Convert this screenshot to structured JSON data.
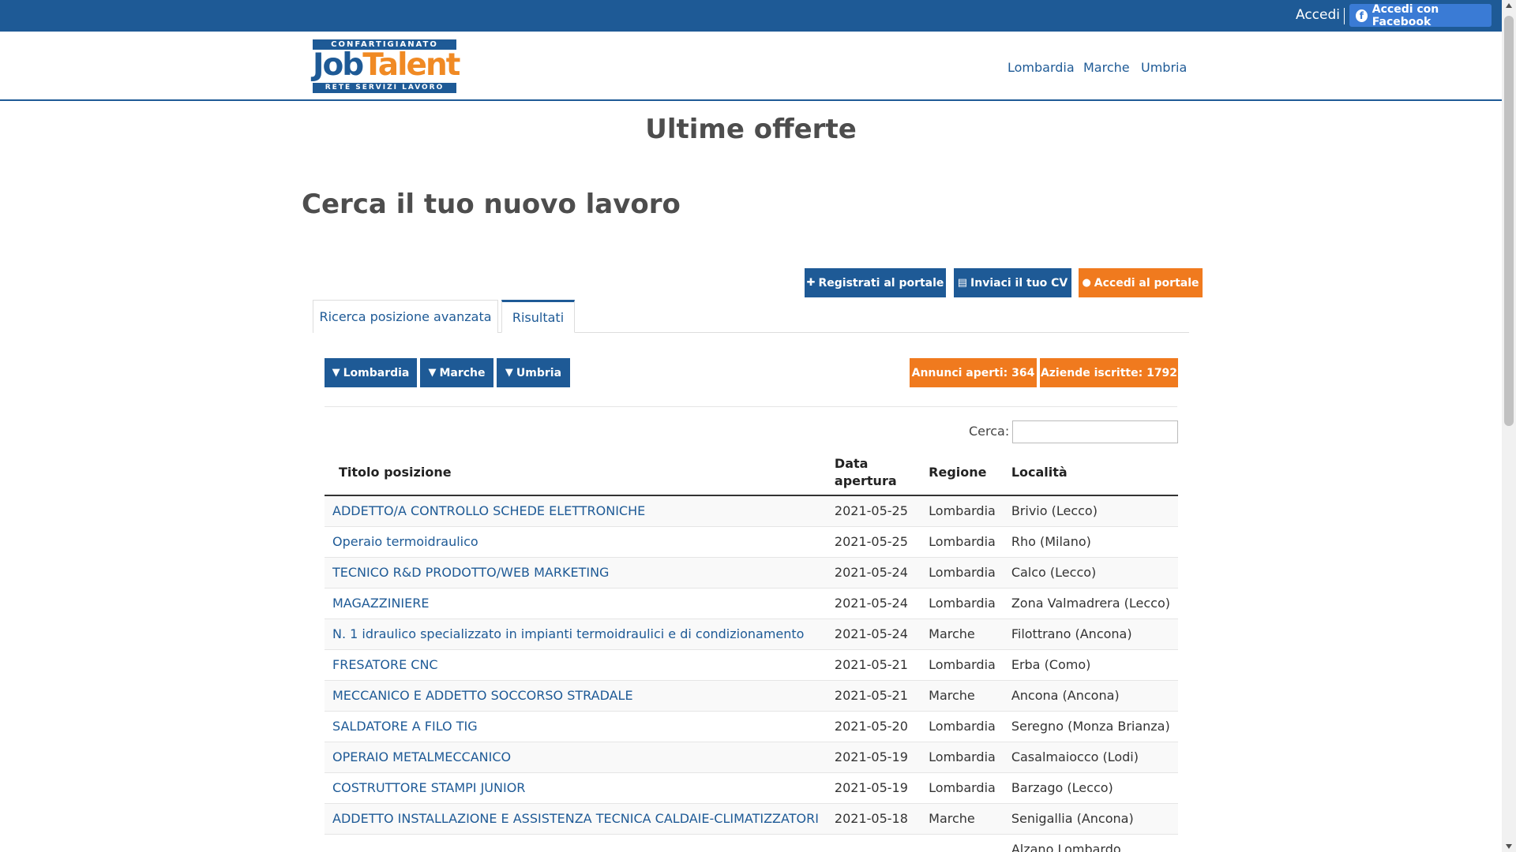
{
  "topbar": {
    "login_label": "Accedi",
    "facebook_label": "Accedi con Facebook"
  },
  "logo": {
    "top_text": "CONFARTIGIANATO",
    "brand_job": "Job",
    "brand_talent": "Talent",
    "bottom_text": "RETE SERVIZI LAVORO"
  },
  "nav": {
    "items": [
      "Lombardia",
      "Marche",
      "Umbria"
    ]
  },
  "main_title": "Ultime offerte",
  "sub_title": "Cerca il tuo nuovo lavoro",
  "actions": {
    "register": "Registrati al portale",
    "send_cv": "Inviaci il tuo CV",
    "login_portal": "Accedi al portale"
  },
  "tabs": {
    "advanced": "Ricerca posizione avanzata",
    "results": "Risultati"
  },
  "filters": [
    "Lombardia",
    "Marche",
    "Umbria"
  ],
  "stats": {
    "open_ads": "Annunci aperti: 364",
    "companies": "Aziende iscritte: 1792"
  },
  "search": {
    "label": "Cerca:"
  },
  "table": {
    "headers": {
      "title": "Titolo posizione",
      "date_line1": "Data",
      "date_line2": "apertura",
      "region": "Regione",
      "location": "Località"
    },
    "rows": [
      {
        "title": "ADDETTO/A CONTROLLO SCHEDE ELETTRONICHE",
        "date": "2021-05-25",
        "region": "Lombardia",
        "location": "Brivio (Lecco)"
      },
      {
        "title": "Operaio termoidraulico",
        "date": "2021-05-25",
        "region": "Lombardia",
        "location": "Rho (Milano)"
      },
      {
        "title": "TECNICO R&D PRODOTTO/WEB MARKETING",
        "date": "2021-05-24",
        "region": "Lombardia",
        "location": "Calco (Lecco)"
      },
      {
        "title": "MAGAZZINIERE",
        "date": "2021-05-24",
        "region": "Lombardia",
        "location": "Zona Valmadrera (Lecco)"
      },
      {
        "title": "N. 1 idraulico specializzato in impianti termoidraulici e di condizionamento",
        "date": "2021-05-24",
        "region": "Marche",
        "location": "Filottrano (Ancona)"
      },
      {
        "title": "FRESATORE CNC",
        "date": "2021-05-21",
        "region": "Lombardia",
        "location": "Erba (Como)"
      },
      {
        "title": "MECCANICO E ADDETTO SOCCORSO STRADALE",
        "date": "2021-05-21",
        "region": "Marche",
        "location": "Ancona (Ancona)"
      },
      {
        "title": "SALDATORE A FILO TIG",
        "date": "2021-05-20",
        "region": "Lombardia",
        "location": "Seregno (Monza Brianza)"
      },
      {
        "title": "OPERAIO METALMECCANICO",
        "date": "2021-05-19",
        "region": "Lombardia",
        "location": "Casalmaiocco (Lodi)"
      },
      {
        "title": "COSTRUTTORE STAMPI JUNIOR",
        "date": "2021-05-19",
        "region": "Lombardia",
        "location": "Barzago (Lecco)"
      },
      {
        "title": "ADDETTO INSTALLAZIONE E ASSISTENZA TECNICA CALDAIE-CLIMATIZZATORI",
        "date": "2021-05-18",
        "region": "Marche",
        "location": "Senigallia (Ancona)"
      },
      {
        "title": "",
        "date": "",
        "region": "",
        "location": "Alzano Lombardo"
      }
    ]
  },
  "colors": {
    "primary_blue": "#1e5a96",
    "accent_orange": "#f07a1e",
    "facebook_blue": "#3a7bd5"
  }
}
